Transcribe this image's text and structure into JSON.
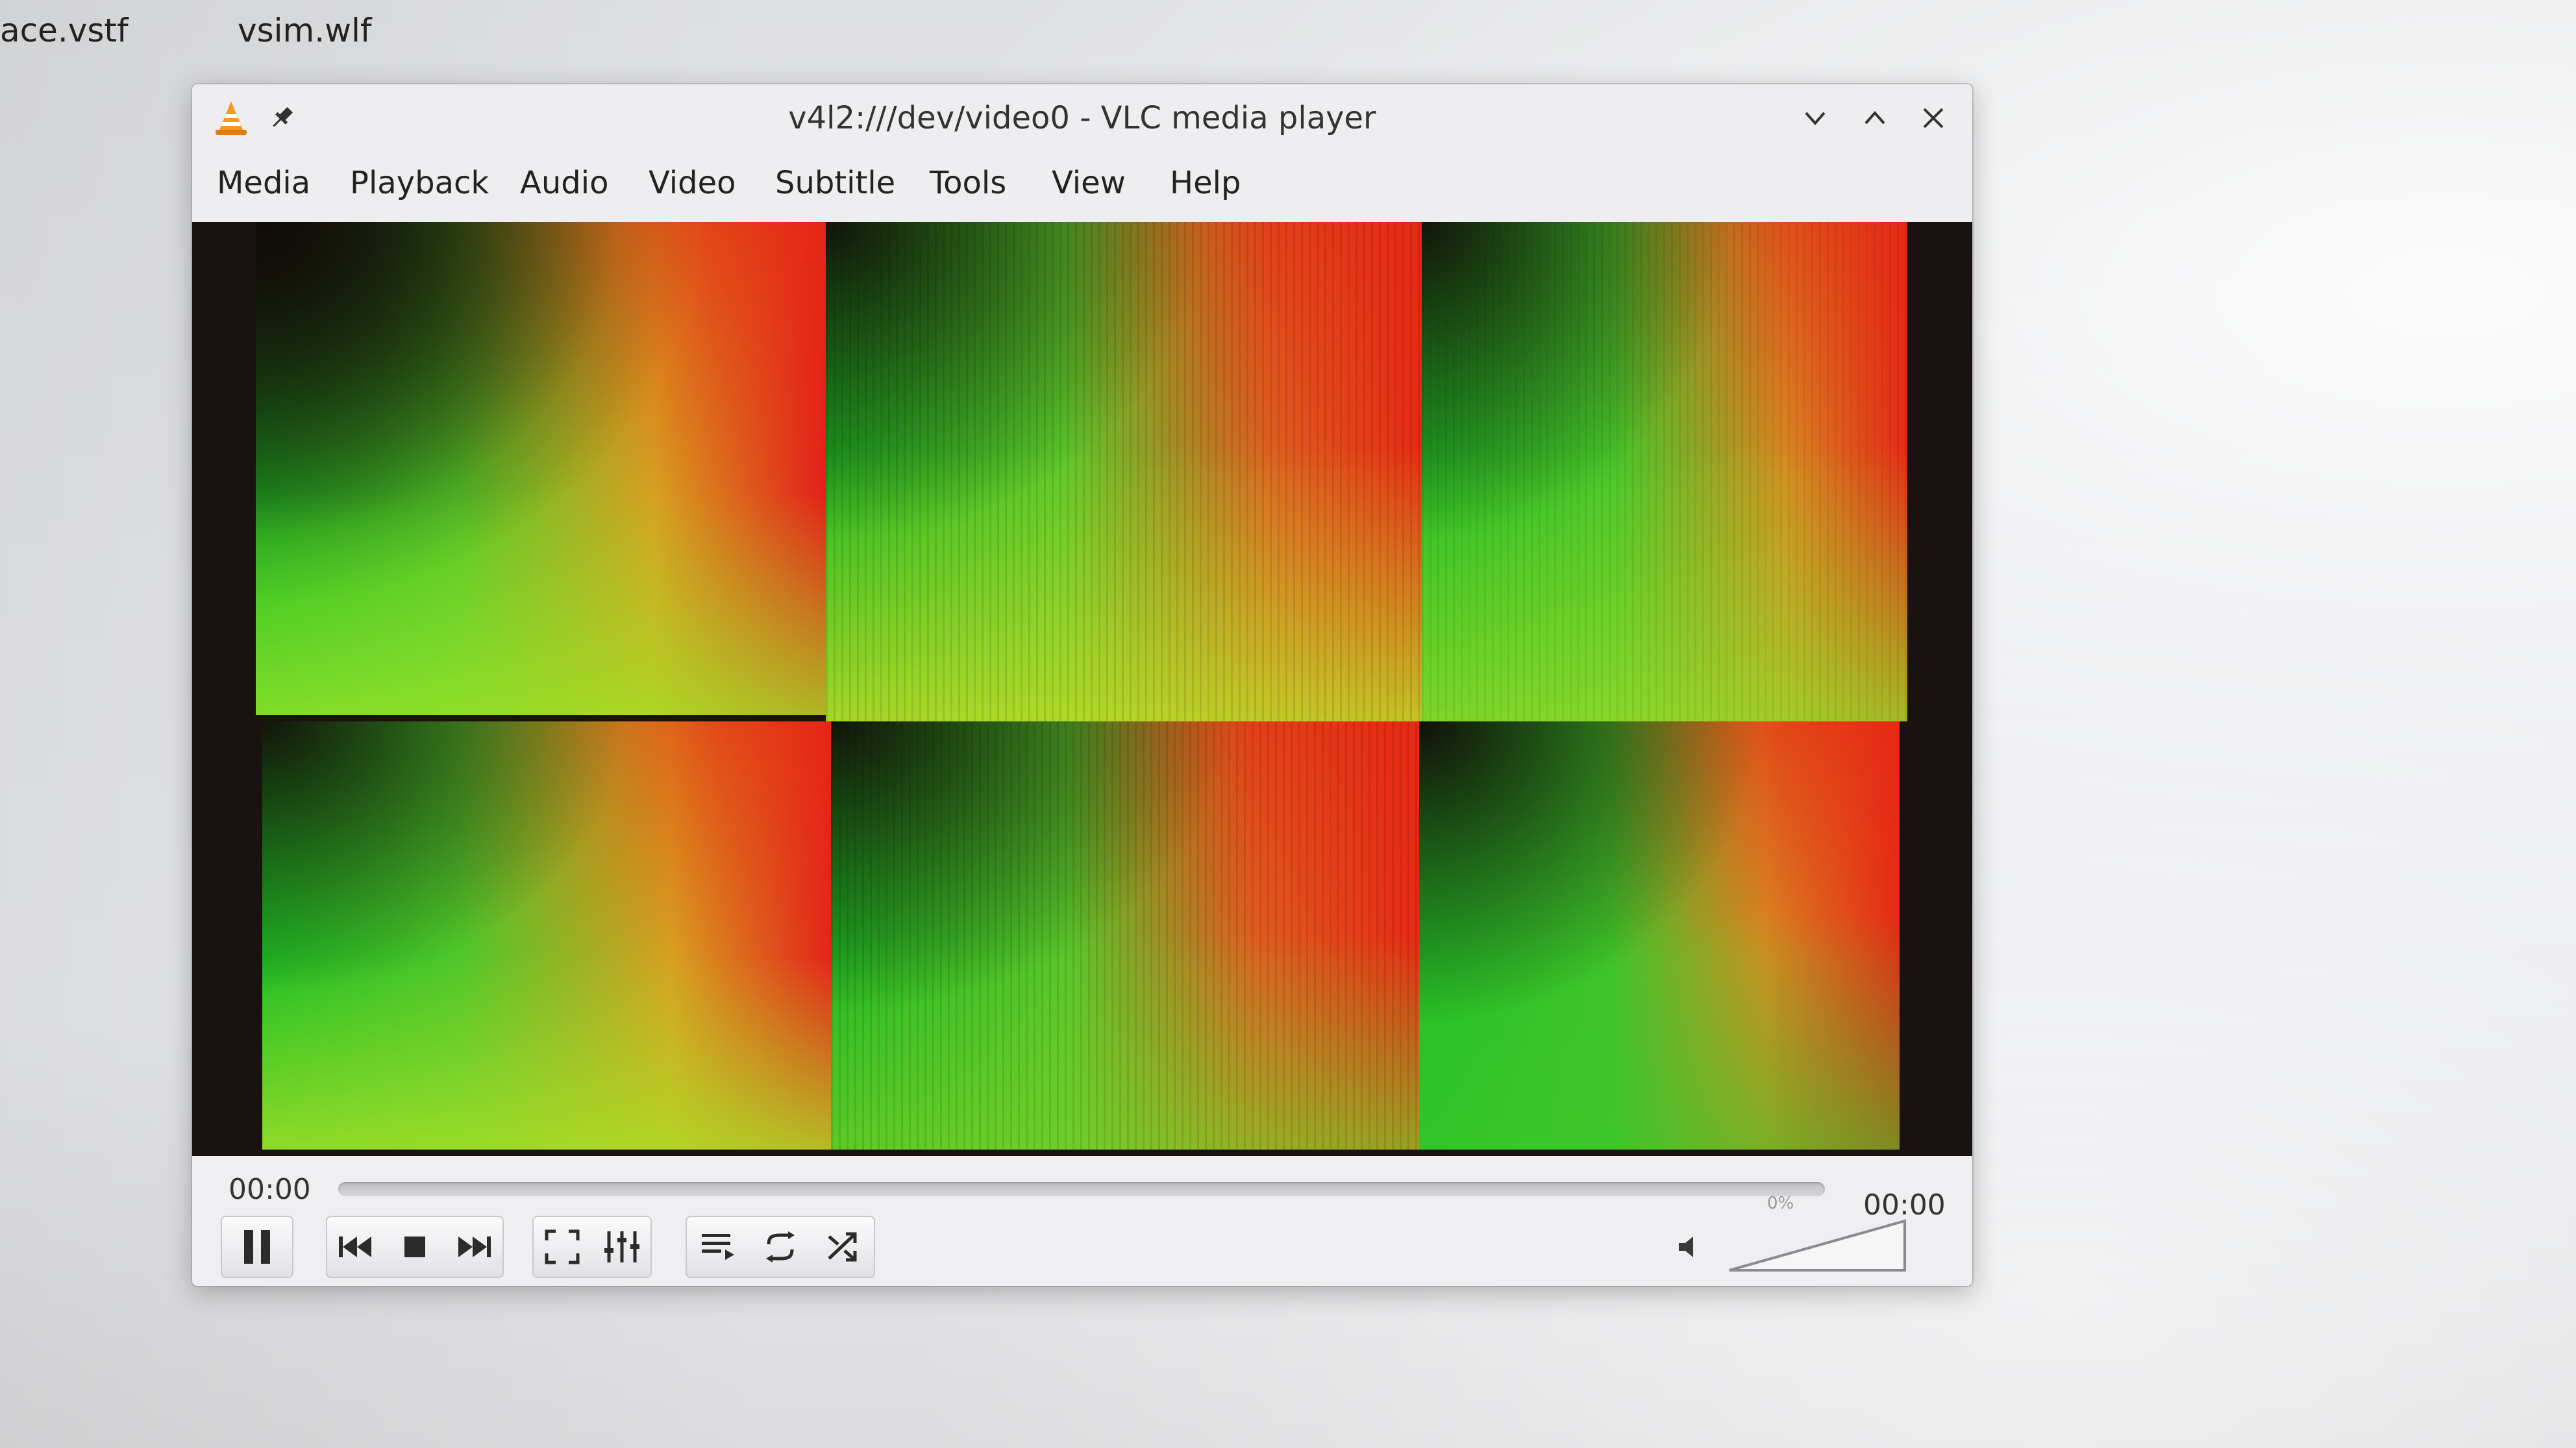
{
  "desktop": {
    "files": [
      "ace.vstf",
      "vsim.wlf"
    ]
  },
  "window": {
    "title": "v4l2:///dev/video0 - VLC media player",
    "icons": {
      "app": "vlc-cone-icon",
      "pin": "pin-icon",
      "minimize": "chevron-down-icon",
      "maximize": "chevron-up-icon",
      "close": "close-icon"
    }
  },
  "menu": {
    "items": [
      "Media",
      "Playback",
      "Audio",
      "Video",
      "Subtitle",
      "Tools",
      "View",
      "Help"
    ]
  },
  "video": {
    "description_colors": {
      "green": "#22c02a",
      "red": "#e82a12",
      "yellow": "#d8d02a",
      "black": "#120c08"
    }
  },
  "controls": {
    "elapsed": "00:00",
    "total": "00:00",
    "progress": 0,
    "volume_label": "0%",
    "volume": 0,
    "buttons": {
      "pause": "pause-icon",
      "previous": "previous-icon",
      "stop": "stop-icon",
      "next": "next-icon",
      "fullscreen": "fullscreen-icon",
      "extended": "equalizer-icon",
      "playlist": "playlist-icon",
      "loop": "loop-icon",
      "random": "shuffle-icon",
      "mute": "speaker-icon"
    }
  }
}
